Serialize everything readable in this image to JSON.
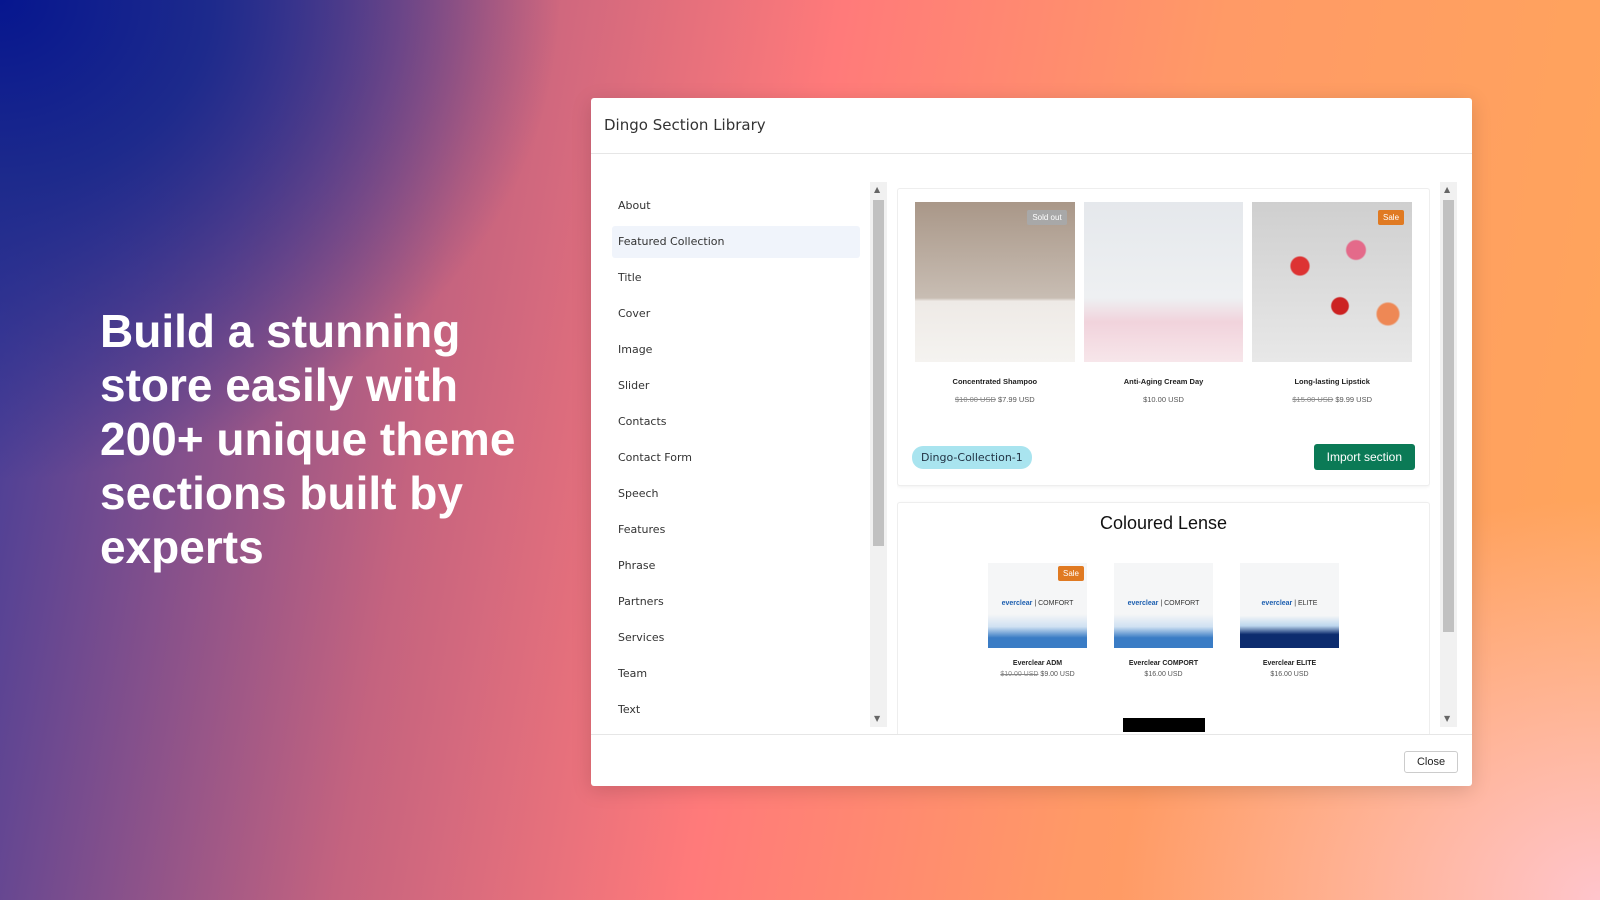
{
  "hero": {
    "headline": "Build a stunning store easily with 200+ unique theme sections built by experts"
  },
  "modal": {
    "title": "Dingo Section Library",
    "close_label": "Close"
  },
  "sidebar": {
    "items": [
      {
        "label": "About"
      },
      {
        "label": "Featured Collection",
        "active": true
      },
      {
        "label": "Title"
      },
      {
        "label": "Cover"
      },
      {
        "label": "Image"
      },
      {
        "label": "Slider"
      },
      {
        "label": "Contacts"
      },
      {
        "label": "Contact Form"
      },
      {
        "label": "Speech"
      },
      {
        "label": "Features"
      },
      {
        "label": "Phrase"
      },
      {
        "label": "Partners"
      },
      {
        "label": "Services"
      },
      {
        "label": "Team"
      },
      {
        "label": "Text"
      }
    ]
  },
  "sections": [
    {
      "tag": "Dingo-Collection-1",
      "import_label": "Import section",
      "products": [
        {
          "name": "Concentrated Shampoo",
          "old_price": "$10.00 USD",
          "price": "$7.99 USD",
          "badge": "Sold out"
        },
        {
          "name": "Anti-Aging Cream Day",
          "old_price": "",
          "price": "$10.00 USD",
          "badge": ""
        },
        {
          "name": "Long-lasting Lipstick",
          "old_price": "$15.00 USD",
          "price": "$9.99 USD",
          "badge": "Sale"
        }
      ]
    },
    {
      "title": "Coloured Lense",
      "products": [
        {
          "name": "Everclear ADM",
          "old_price": "$10.00 USD",
          "price": "$9.00 USD",
          "badge": "Sale",
          "brand": "everclear",
          "line": "COMFORT"
        },
        {
          "name": "Everclear COMPORT",
          "old_price": "",
          "price": "$16.00 USD",
          "badge": "",
          "brand": "everclear",
          "line": "COMFORT"
        },
        {
          "name": "Everclear ELITE",
          "old_price": "",
          "price": "$16.00 USD",
          "badge": "",
          "brand": "everclear",
          "line": "ELITE"
        }
      ]
    }
  ],
  "colors": {
    "import": "#0b7a56",
    "tag": "#a9e4ef",
    "sale": "#e07a22",
    "soldout": "#a8a8a8"
  }
}
